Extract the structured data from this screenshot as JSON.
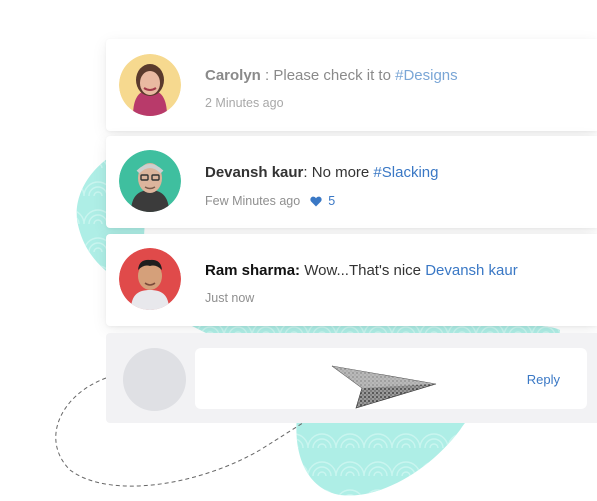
{
  "comments": [
    {
      "name": "Carolyn",
      "separator": " : ",
      "text": "Please check it to ",
      "tag": "#Designs",
      "time": "2 Minutes ago"
    },
    {
      "name": "Devansh kaur",
      "separator": ": ",
      "text": "No more ",
      "tag": "#Slacking",
      "time": "Few Minutes ago",
      "likes": "5"
    },
    {
      "name": "Ram sharma:",
      "separator": " ",
      "text": "Wow...That's nice ",
      "mention": "Devansh kaur",
      "time": "Just now"
    }
  ],
  "reply": {
    "button_label": "Reply"
  },
  "colors": {
    "accent": "#3a78c5",
    "blob": "#a8ece4",
    "avatar_carolyn_bg": "#f6d98f",
    "avatar_devansh_bg": "#3fbf9f",
    "avatar_ram_bg": "#e04a4a"
  },
  "icons": {
    "like": "heart-icon",
    "send": "paper-plane-icon"
  }
}
